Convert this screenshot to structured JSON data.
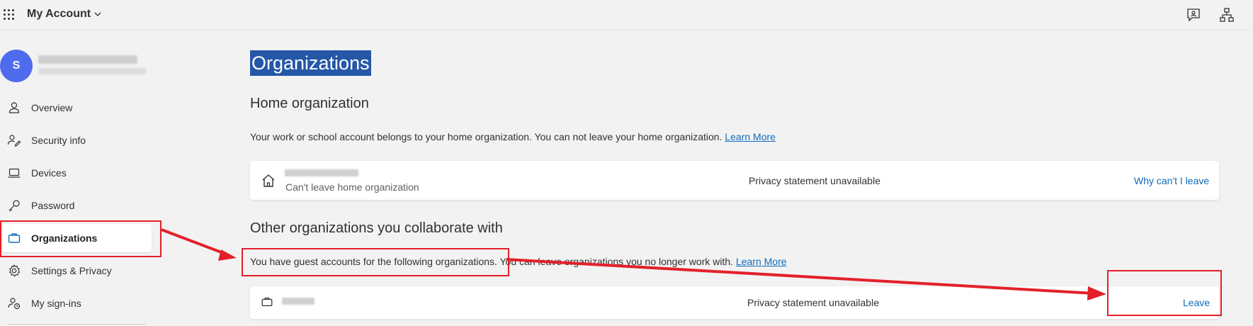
{
  "header": {
    "app_title": "My Account",
    "icons": [
      "waffle-icon",
      "chevron-down-icon",
      "feedback-icon",
      "organization-chart-icon"
    ]
  },
  "user": {
    "avatar_initial": "S"
  },
  "sidebar": {
    "items": [
      {
        "label": "Overview",
        "icon": "person-icon"
      },
      {
        "label": "Security info",
        "icon": "security-info-icon"
      },
      {
        "label": "Devices",
        "icon": "laptop-icon"
      },
      {
        "label": "Password",
        "icon": "key-icon"
      },
      {
        "label": "Organizations",
        "icon": "briefcase-icon",
        "active": true
      },
      {
        "label": "Settings & Privacy",
        "icon": "gear-icon"
      },
      {
        "label": "My sign-ins",
        "icon": "sign-ins-icon"
      }
    ]
  },
  "main": {
    "page_title": "Organizations",
    "home": {
      "heading": "Home organization",
      "description": "Your work or school account belongs to your home organization. You can not leave your home organization.",
      "learn_more": "Learn More",
      "card": {
        "subtitle": "Can't leave home organization",
        "privacy": "Privacy statement unavailable",
        "action": "Why can't I leave"
      }
    },
    "other": {
      "heading": "Other organizations you collaborate with",
      "description": "You have guest accounts for the following organizations. You can leave organizations you no longer work with.",
      "learn_more": "Learn More",
      "card": {
        "privacy": "Privacy statement unavailable",
        "action": "Leave"
      }
    }
  },
  "colors": {
    "accent": "#0f6cbd",
    "avatar": "#4f6bed",
    "highlight": "#2557a7",
    "annotation": "#e3202a"
  }
}
